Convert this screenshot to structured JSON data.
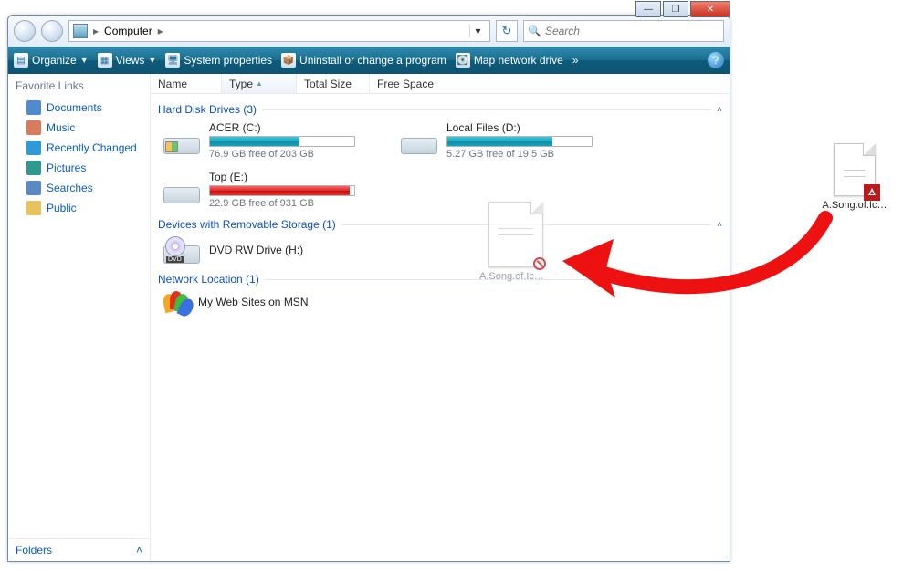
{
  "titlebar": {
    "min": "—",
    "max": "❐",
    "close": "✕"
  },
  "nav": {
    "location_root": "Computer",
    "separator": "▸",
    "search_placeholder": "Search"
  },
  "toolbar": {
    "organize": "Organize",
    "views": "Views",
    "system_properties": "System properties",
    "uninstall": "Uninstall or change a program",
    "map_drive": "Map network drive",
    "more": "»"
  },
  "sidebar": {
    "heading": "Favorite Links",
    "items": [
      {
        "label": "Documents",
        "color": "#4f8bd0"
      },
      {
        "label": "Music",
        "color": "#d97b5d"
      },
      {
        "label": "Recently Changed",
        "color": "#2e9ad8"
      },
      {
        "label": "Pictures",
        "color": "#2f9990"
      },
      {
        "label": "Searches",
        "color": "#5b89c4"
      },
      {
        "label": "Public",
        "color": "#e8c25b"
      }
    ],
    "folders": "Folders"
  },
  "columns": {
    "name": "Name",
    "type": "Type",
    "total_size": "Total Size",
    "free_space": "Free Space"
  },
  "sections": {
    "hdd": "Hard Disk Drives (3)",
    "removable": "Devices with Removable Storage (1)",
    "network": "Network Location (1)"
  },
  "drives": {
    "c": {
      "title": "ACER (C:)",
      "free": "76.9 GB free of 203 GB",
      "fill": 62
    },
    "d": {
      "title": "Local Files (D:)",
      "free": "5.27 GB free of 19.5 GB",
      "fill": 73
    },
    "e": {
      "title": "Top (E:)",
      "free": "22.9 GB free of 931 GB",
      "fill": 97
    },
    "dvd": {
      "title": "DVD RW Drive (H:)"
    },
    "msn": {
      "title": "My Web Sites on MSN"
    }
  },
  "drag": {
    "ghost_label": "A.Song.of.Ic…",
    "desktop_label": "A.Song.of.Ic…"
  },
  "blurred": {
    "a": "",
    "b": ""
  }
}
